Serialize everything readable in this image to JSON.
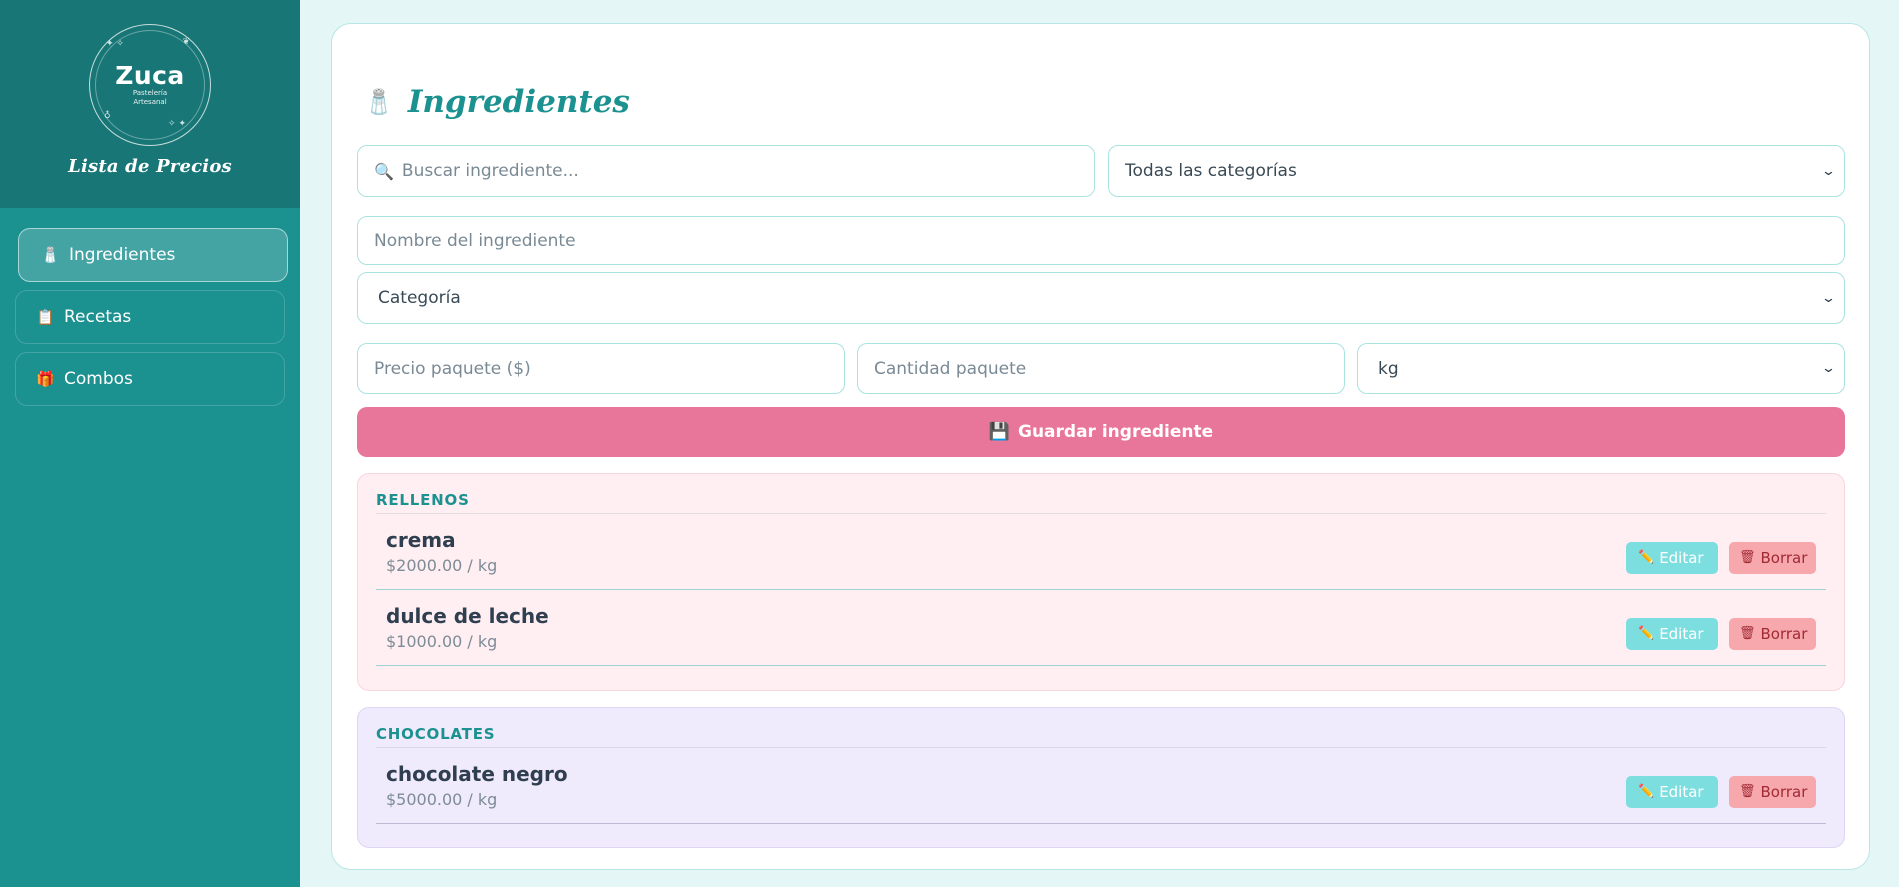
{
  "brand": {
    "name": "Zuca",
    "tagline_line1": "Pastelería",
    "tagline_line2": "Artesanal",
    "subtitle": "Lista de Precios"
  },
  "nav": {
    "items": [
      {
        "label": "Ingredientes",
        "icon": "salt-shaker-icon",
        "active": true
      },
      {
        "label": "Recetas",
        "icon": "notepad-icon",
        "active": false
      },
      {
        "label": "Combos",
        "icon": "gift-icon",
        "active": false
      }
    ]
  },
  "page": {
    "title": "Ingredientes",
    "title_icon": "salt-shaker-icon"
  },
  "filters": {
    "search_placeholder": "Buscar ingrediente...",
    "category_filter_value": "Todas las categorías"
  },
  "form": {
    "name_placeholder": "Nombre del ingrediente",
    "category_value": "Categoría",
    "price_placeholder": "Precio paquete ($)",
    "quantity_placeholder": "Cantidad paquete",
    "unit_value": "kg",
    "save_label": "Guardar ingrediente"
  },
  "groups": [
    {
      "name": "RELLENOS",
      "items": [
        {
          "name": "crema",
          "price": "$2000.00 / kg"
        },
        {
          "name": "dulce de leche",
          "price": "$1000.00 / kg"
        }
      ]
    },
    {
      "name": "CHOCOLATES",
      "items": [
        {
          "name": "chocolate negro",
          "price": "$5000.00 / kg"
        }
      ]
    }
  ],
  "actions": {
    "edit_label": "Editar",
    "delete_label": "Borrar"
  },
  "colors": {
    "sidebar": "#1b9190",
    "sidebar_header": "#187776",
    "accent": "#1b9190",
    "save_button": "#e8759a",
    "edit_button": "#7ddedf",
    "delete_button": "#f6a8ad",
    "group_rellenos_bg": "#ffeef2",
    "group_chocolates_bg": "#efeafc"
  }
}
